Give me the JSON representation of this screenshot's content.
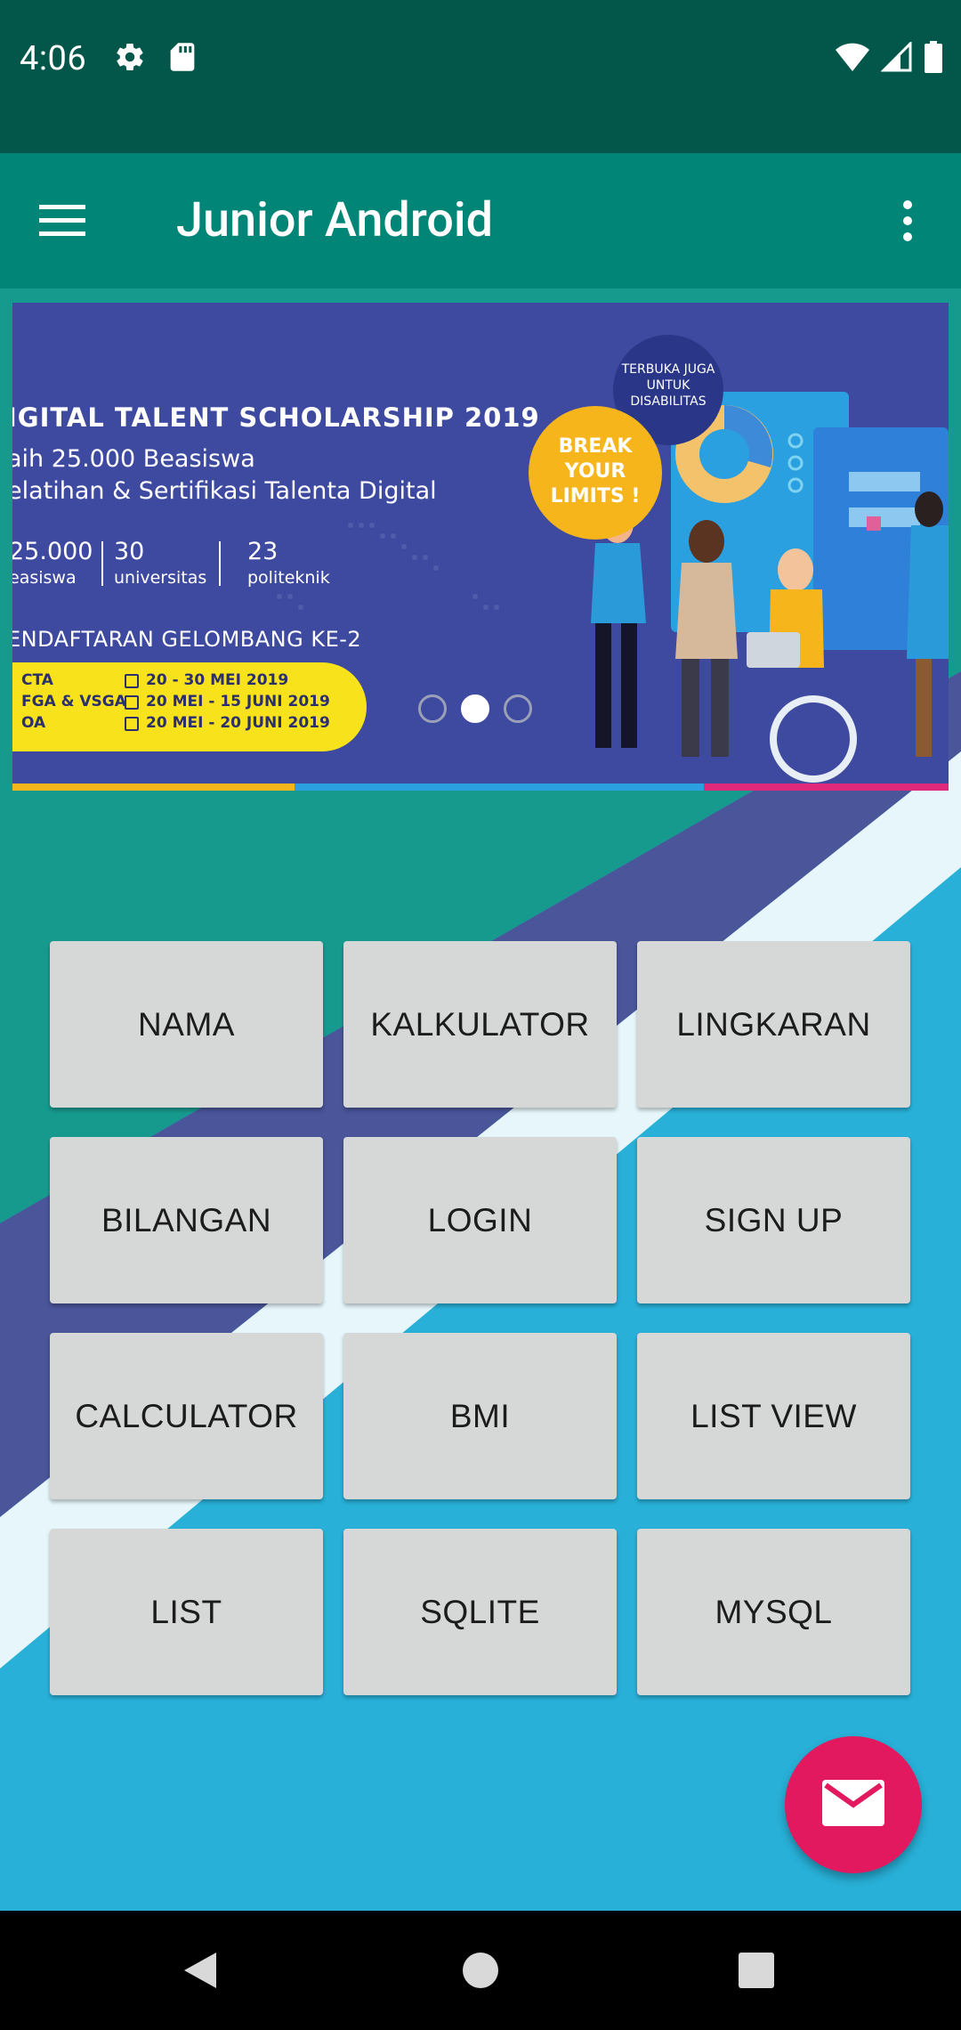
{
  "status_bar": {
    "time": "4:06",
    "icons": [
      "settings-icon",
      "sd-card-icon",
      "wifi-icon",
      "signal-icon",
      "battery-icon"
    ]
  },
  "app_bar": {
    "title": "Junior Android",
    "menu_icon": "hamburger-menu-icon",
    "overflow_icon": "more-vert-icon"
  },
  "banner": {
    "title": "IGITAL TALENT SCHOLARSHIP 2019",
    "line1": "aih 25.000 Beasiswa",
    "line2": "elatihan & Sertifikasi Talenta Digital",
    "stats": [
      {
        "num": "25.000",
        "label": "easiswa"
      },
      {
        "num": "30",
        "label": "universitas"
      },
      {
        "num": "23",
        "label": "politeknik"
      }
    ],
    "wave": "ENDAFTARAN GELOMBANG KE-2",
    "schedule": [
      {
        "program": "CTA",
        "dates": "20 - 30 MEI 2019"
      },
      {
        "program": "FGA & VSGA",
        "dates": "20 MEI - 15 JUNI 2019"
      },
      {
        "program": "OA",
        "dates": "20 MEI - 20 JUNI 2019"
      }
    ],
    "badge": "TERBUKA JUGA UNTUK DISABILITAS",
    "break_text": "BREAK YOUR LIMITS !",
    "page_count": 3,
    "active_page": 2
  },
  "buttons": [
    "NAMA",
    "KALKULATOR",
    "LINGKARAN",
    "BILANGAN",
    "LOGIN",
    "SIGN UP",
    "CALCULATOR",
    "BMI",
    "LIST VIEW",
    "LIST",
    "SQLITE",
    "MYSQL"
  ],
  "fab": {
    "icon": "email-icon"
  },
  "colors": {
    "status_bar": "#02574a",
    "app_bar": "#008577",
    "background_blue": "#28b0d8",
    "teal": "#179a8e",
    "indigo": "#4a559a",
    "button": "#d6d7d7",
    "fab": "#e3195f"
  }
}
